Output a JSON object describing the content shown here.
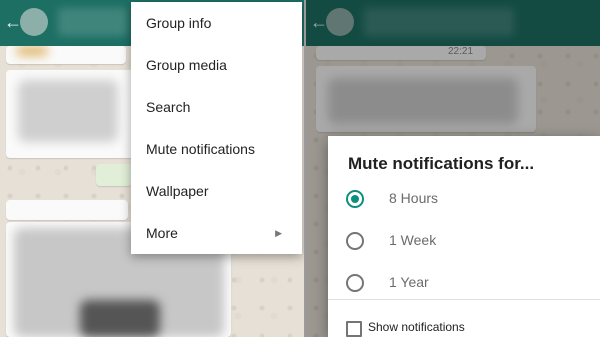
{
  "left_screen": {
    "menu_items": [
      {
        "label": "Group info"
      },
      {
        "label": "Group media"
      },
      {
        "label": "Search"
      },
      {
        "label": "Mute notifications"
      },
      {
        "label": "Wallpaper"
      },
      {
        "label": "More",
        "submenu_icon": "chevron-right-icon"
      }
    ]
  },
  "right_screen": {
    "timestamp": "22:21",
    "dialog": {
      "title": "Mute notifications for...",
      "options": [
        {
          "label": "8 Hours",
          "selected": true
        },
        {
          "label": "1 Week",
          "selected": false
        },
        {
          "label": "1 Year",
          "selected": false
        }
      ],
      "checkbox": {
        "label": "Show notifications",
        "checked": false
      }
    }
  },
  "colors": {
    "header": "#1d6f64",
    "accent": "#0e8f7e"
  }
}
